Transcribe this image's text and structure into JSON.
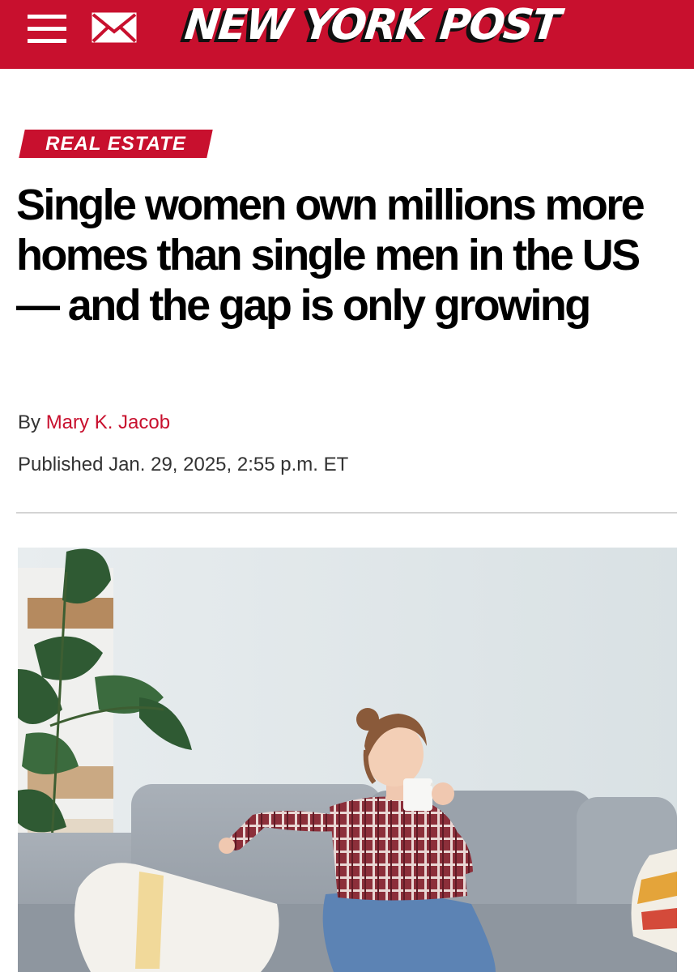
{
  "header": {
    "logo_text": "NEW YORK POST",
    "menu_icon": "hamburger-menu-icon",
    "mail_icon": "mail-icon",
    "brand_color": "#c8102e"
  },
  "article": {
    "section": "REAL ESTATE",
    "headline": "Single women own millions more homes than single men in the US — and the gap is only growing",
    "byline_prefix": "By",
    "author": "Mary K. Jacob",
    "published": "Published Jan. 29, 2025, 2:55 p.m. ET"
  },
  "hero_image": {
    "subject": "woman-on-sofa-with-mug"
  }
}
